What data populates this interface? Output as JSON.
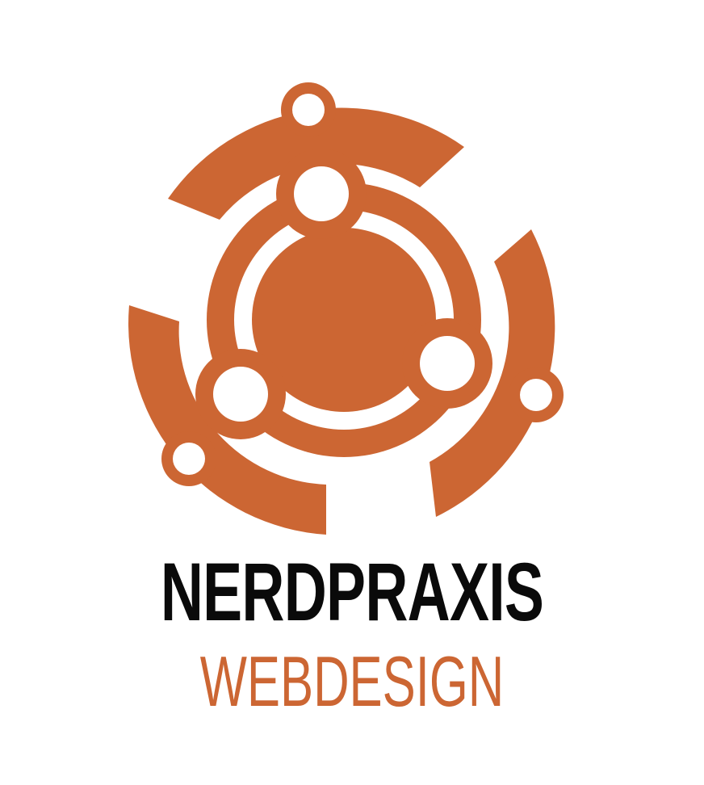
{
  "brand": {
    "name": "NERDPRAXIS",
    "tagline": "WEBDESIGN"
  },
  "colors": {
    "accent": "#cc6633",
    "text_dark": "#0a0a0a",
    "background": "#ffffff"
  },
  "icon": "network-ring-logo-icon"
}
